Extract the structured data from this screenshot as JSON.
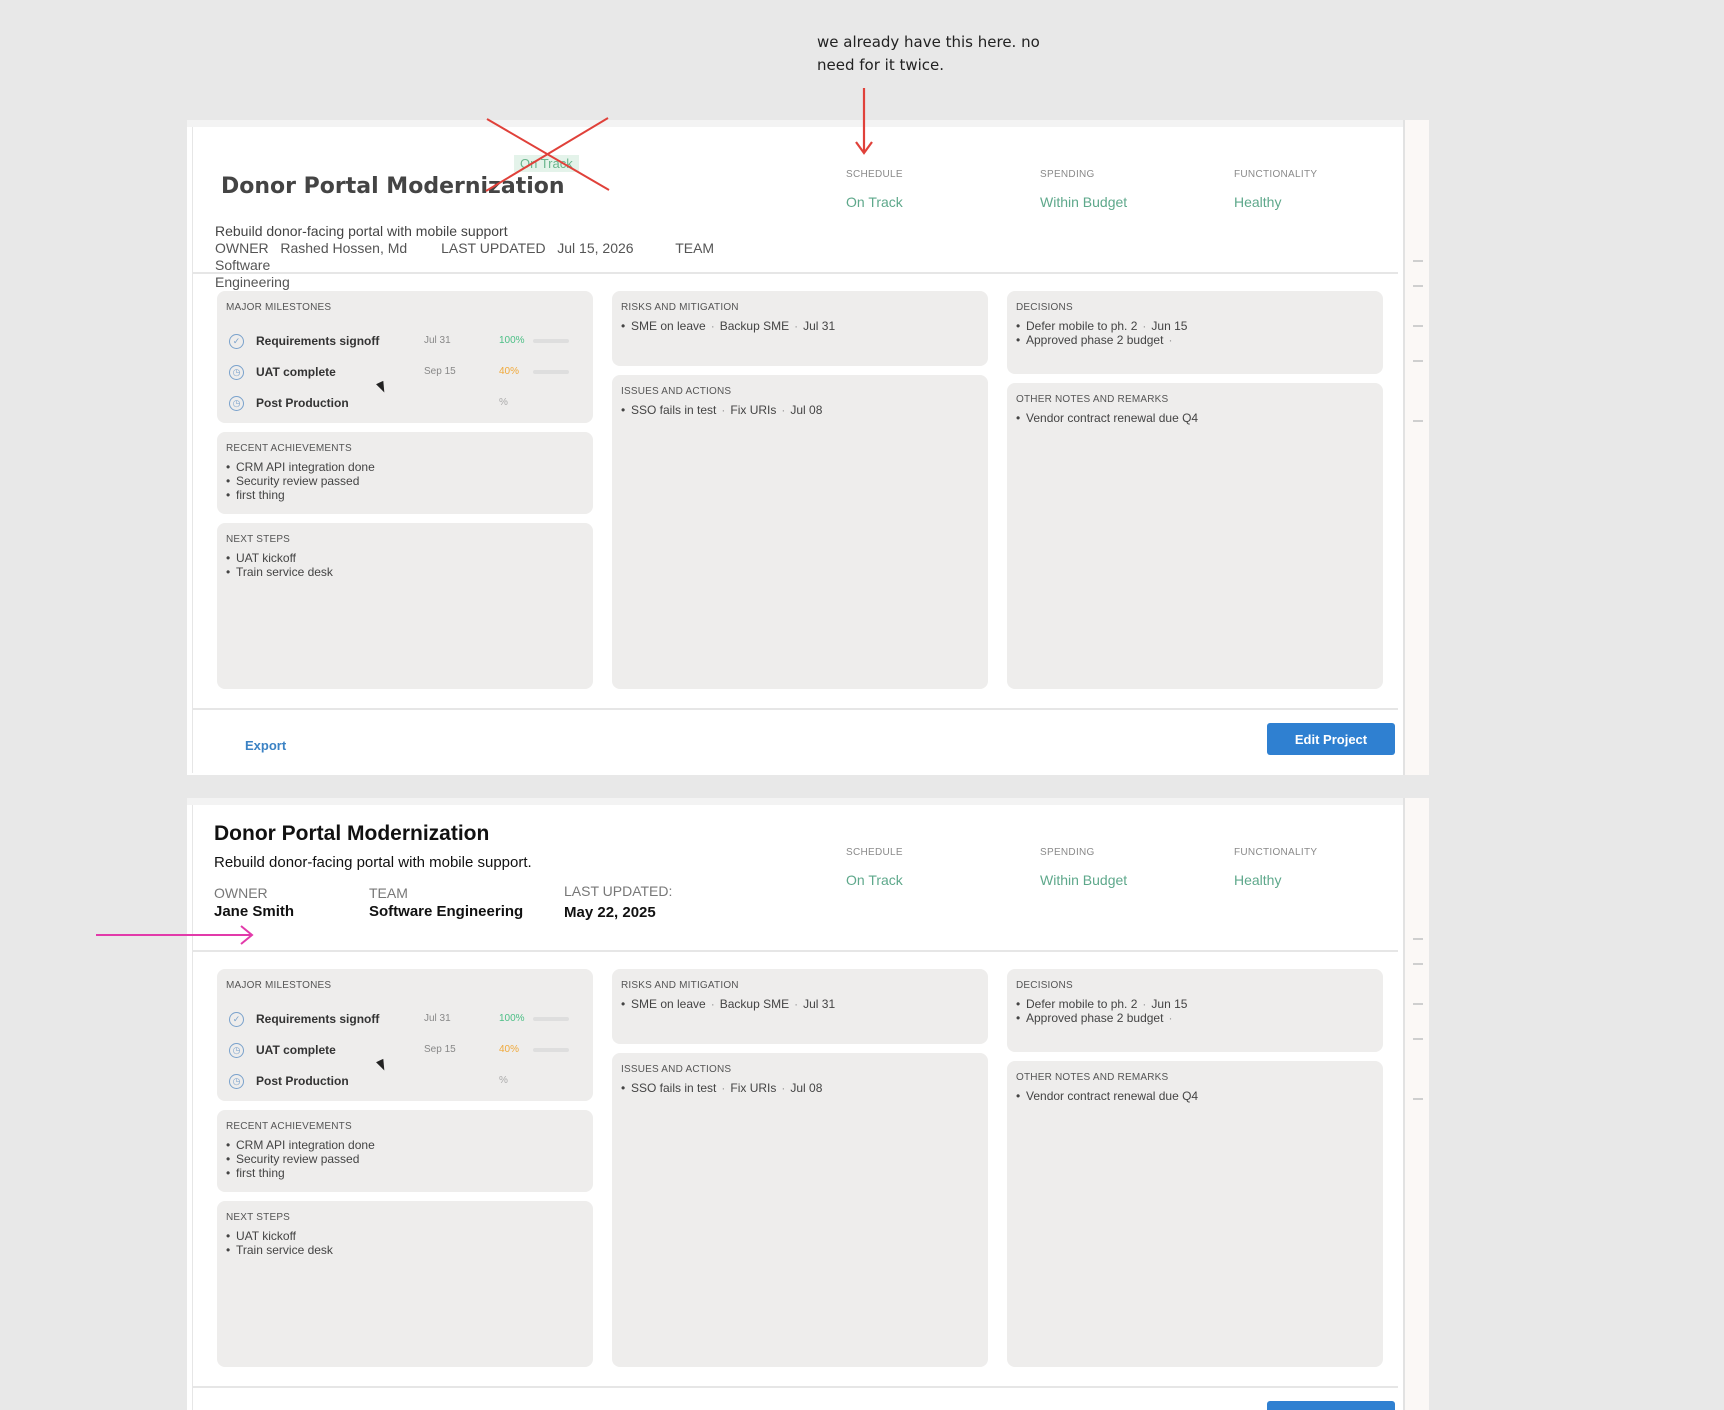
{
  "annotation": {
    "note_line1": "we already have this here. no",
    "note_line2": "need for it twice."
  },
  "colors": {
    "accent_blue": "#2f80d1",
    "status_green": "#5ea88b",
    "annotation_red": "#e0413a",
    "annotation_magenta": "#e23aaa"
  },
  "v1": {
    "title": "Donor Portal Modernization",
    "badge": "On Track",
    "description": "Rebuild donor-facing portal with mobile support",
    "owner_label": "OWNER",
    "owner": "Rashed Hossen, Md",
    "updated_label": "LAST UPDATED",
    "updated": "Jul 15, 2026",
    "team_label": "TEAM",
    "team_line1": "Software",
    "team_line2": "Engineering",
    "status": [
      {
        "label": "SCHEDULE",
        "value": "On Track"
      },
      {
        "label": "SPENDING",
        "value": "Within Budget"
      },
      {
        "label": "FUNCTIONALITY",
        "value": "Healthy"
      }
    ],
    "export": "Export",
    "edit": "Edit Project"
  },
  "v2": {
    "title": "Donor Portal Modernization",
    "description": "Rebuild donor-facing portal with mobile support.",
    "owner_label": "OWNER",
    "owner": "Jane Smith",
    "team_label": "TEAM",
    "team": "Software Engineering",
    "updated_label": "LAST UPDATED:",
    "updated": "May 22, 2025",
    "status": [
      {
        "label": "SCHEDULE",
        "value": "On Track"
      },
      {
        "label": "SPENDING",
        "value": "Within Budget"
      },
      {
        "label": "FUNCTIONALITY",
        "value": "Healthy"
      }
    ]
  },
  "panels": {
    "milestones_title": "MAJOR MILESTONES",
    "milestones": [
      {
        "name": "Requirements signoff",
        "date": "Jul 31",
        "pct": "100%",
        "progress": 1.0,
        "color": "#4cbf86",
        "icon": "check-circle-icon",
        "glyph": "✓"
      },
      {
        "name": "UAT complete",
        "date": "Sep 15",
        "pct": "40%",
        "progress": 1.0,
        "color": "#f0a93b",
        "icon": "clock-icon",
        "glyph": "◷"
      },
      {
        "name": "Post Production",
        "date": "",
        "pct": "%",
        "progress": 0,
        "color": "#cccccc",
        "icon": "clock-icon",
        "glyph": "◷"
      }
    ],
    "achievements_title": "RECENT ACHIEVEMENTS",
    "achievements": [
      "CRM API integration done",
      "Security review passed",
      "first thing"
    ],
    "next_title": "NEXT STEPS",
    "next": [
      "UAT kickoff",
      "Train service desk"
    ],
    "risks_title": "RISKS AND MITIGATION",
    "risk_1": "SME on leave",
    "risk_1_mitigation": "Backup SME",
    "risk_1_date": "Jul 31",
    "issues_title": "ISSUES AND ACTIONS",
    "issue_1": "SSO fails in test",
    "issue_1_action": "Fix URIs",
    "issue_1_date": "Jul 08",
    "decisions_title": "DECISIONS",
    "decision_1": "Defer mobile to ph. 2",
    "decision_1_date": "Jun 15",
    "decision_2": "Approved phase 2 budget",
    "notes_title": "OTHER NOTES AND REMARKS",
    "note_1": "Vendor contract renewal due Q4"
  }
}
